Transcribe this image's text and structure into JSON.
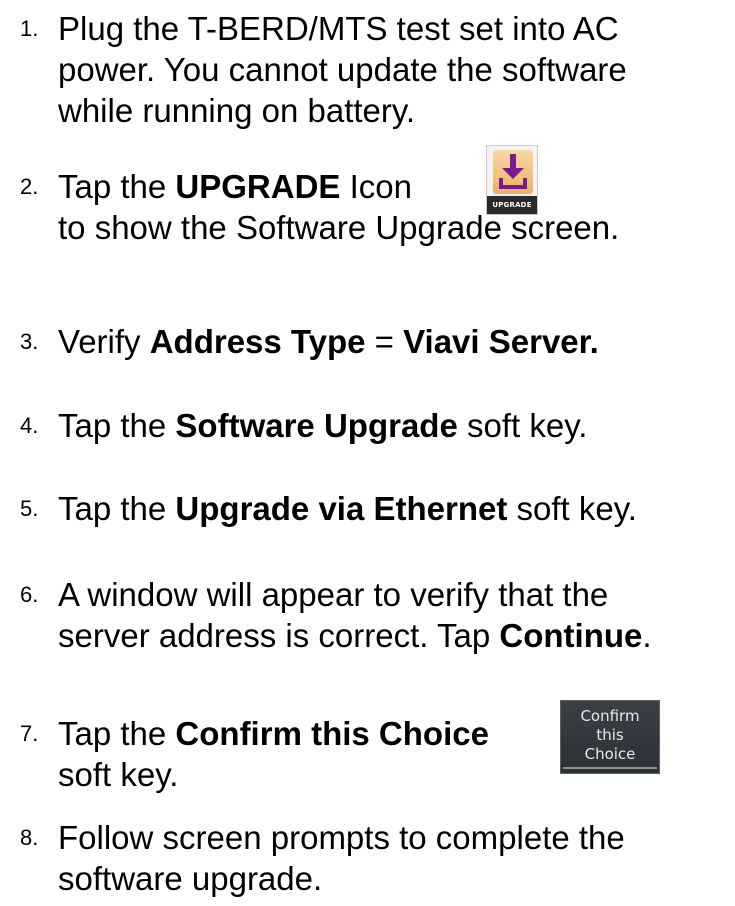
{
  "steps": [
    {
      "number": "1.",
      "lines": [
        "Plug the T-BERD/MTS test set into AC",
        "power.  You cannot update the software",
        "while running on battery."
      ]
    },
    {
      "number": "2.",
      "before": "Tap the ",
      "bold": "UPGRADE",
      "after": " Icon",
      "line2": "to show the Software Upgrade screen."
    },
    {
      "number": "3.",
      "before": "Verify ",
      "bold1": "Address Type",
      "middle": " = ",
      "bold2": "Viavi Server."
    },
    {
      "number": "4.",
      "before": "Tap the ",
      "bold": "Software Upgrade",
      "after": " soft key."
    },
    {
      "number": "5.",
      "before": "Tap the ",
      "bold": "Upgrade via Ethernet",
      "after": " soft key."
    },
    {
      "number": "6.",
      "line1": "A window will appear to verify that the",
      "line2_before": "server address is correct.  Tap ",
      "line2_bold": "Continue",
      "line2_after": "."
    },
    {
      "number": "7.",
      "before": "Tap the ",
      "bold": "Confirm this Choice",
      "line2": "soft key."
    },
    {
      "number": "8.",
      "lines": [
        "Follow screen prompts to complete the",
        "software upgrade."
      ]
    }
  ],
  "upgrade_icon": {
    "label": "UPGRADE",
    "icon": "download-tray-icon",
    "art_color": "#e9b366",
    "arrow_color": "#7a1a8c"
  },
  "confirm_key": {
    "lines": [
      "Confirm",
      "this",
      "Choice"
    ],
    "bg_color": "#2f3539",
    "text_color": "#e6e9ea"
  }
}
